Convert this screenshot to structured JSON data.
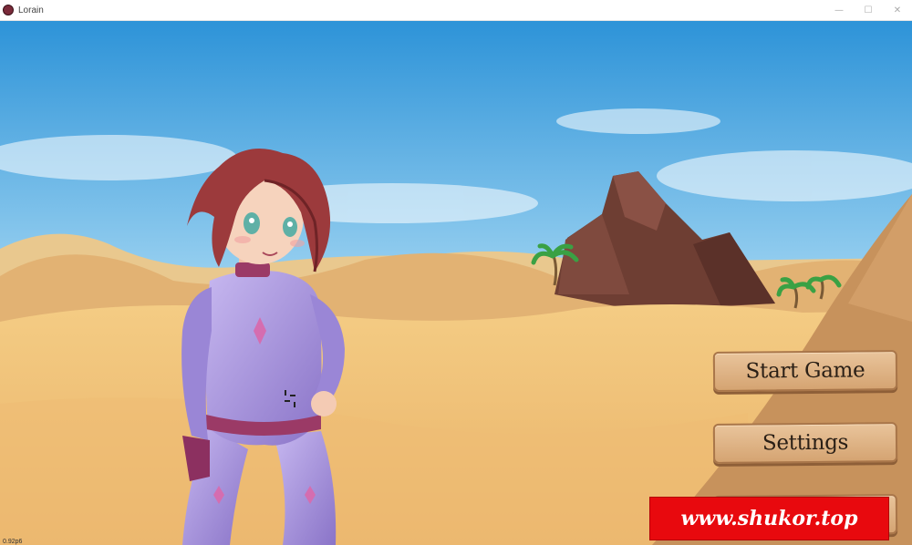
{
  "window": {
    "title": "Lorain",
    "controls": {
      "minimize": "—",
      "maximize": "☐",
      "close": "✕"
    }
  },
  "menu": {
    "start_label": "Start Game",
    "settings_label": "Settings"
  },
  "watermark": "www.shukor.top",
  "version": "0.92p6",
  "colors": {
    "sky_top": "#2d93d8",
    "sand": "#f1c679",
    "button_wood": "#ddb07f",
    "watermark_red": "#e8090e",
    "suit_purple": "#9a86d6"
  }
}
